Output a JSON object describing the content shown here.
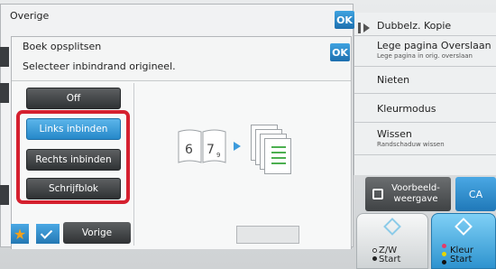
{
  "back_dialog": {
    "title": "Overige",
    "ok_label": "OK"
  },
  "front_dialog": {
    "title": "Boek opsplitsen",
    "ok_label": "OK",
    "instruction": "Selecteer inbindrand origineel.",
    "options": [
      {
        "label": "Off",
        "selected": false
      },
      {
        "label": "Links inbinden",
        "selected": true
      },
      {
        "label": "Rechts inbinden",
        "selected": false
      },
      {
        "label": "Schrijfblok",
        "selected": false
      }
    ],
    "illustration": {
      "page_numbers": [
        "6",
        "7",
        "9"
      ]
    }
  },
  "right_menu": [
    {
      "label": "Dubbelz. Kopie",
      "sub": ""
    },
    {
      "label": "Lege pagina Overslaan",
      "sub": "Lege pagina in orig. overslaan"
    },
    {
      "label": "Nieten",
      "sub": ""
    },
    {
      "label": "Kleurmodus",
      "sub": ""
    },
    {
      "label": "Wissen",
      "sub": "Randschaduw wissen"
    }
  ],
  "preview_button": {
    "label": "Voorbeeld-weergave"
  },
  "ca_button": {
    "label": "CA"
  },
  "start_bw": {
    "label_line1": "Z/W",
    "label_line2": "Start"
  },
  "start_color": {
    "label_line1": "Kleur",
    "label_line2": "Start"
  },
  "bottom_bar": {
    "vorige_label": "Vorige"
  },
  "colors": {
    "accent_blue": "#2688c9",
    "selection_red": "#d5202f",
    "dark_button": "#2f3234"
  }
}
